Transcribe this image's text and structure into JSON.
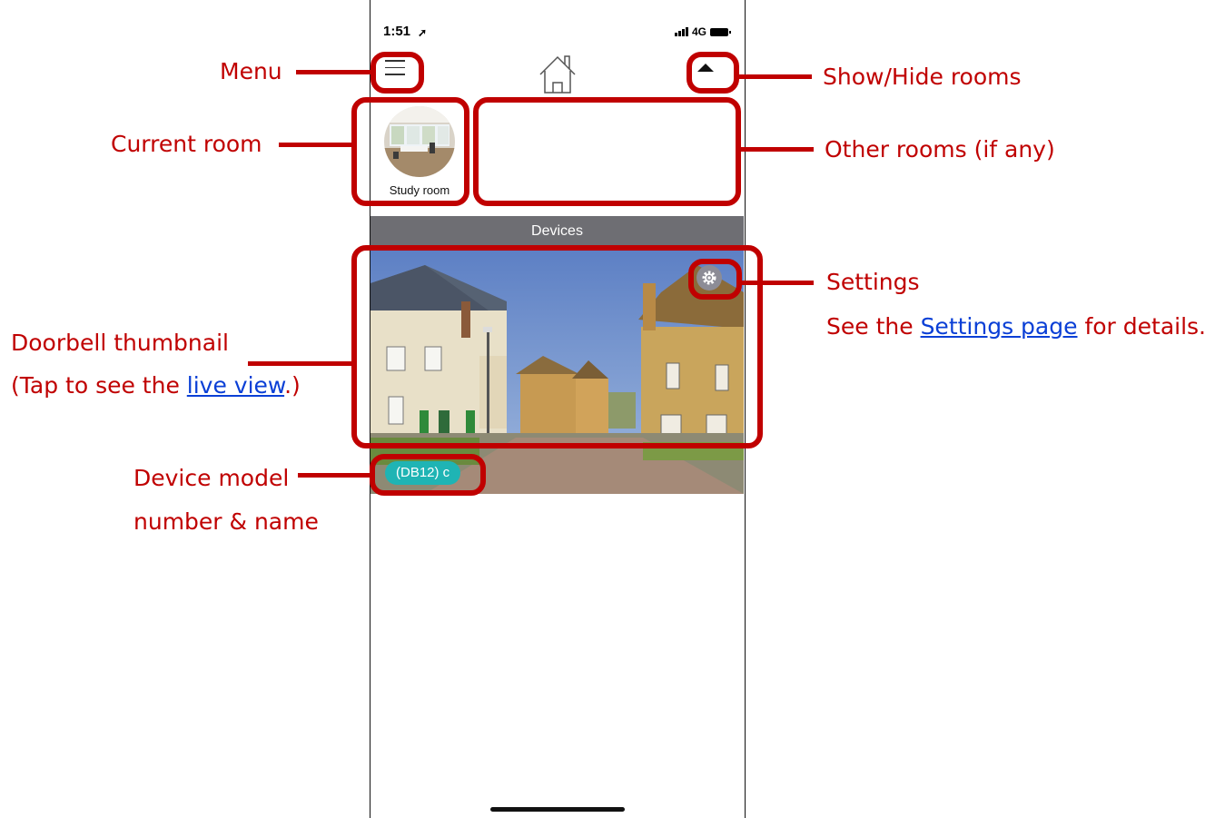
{
  "phone": {
    "status": {
      "time": "1:51",
      "network": "4G"
    },
    "current_room": {
      "label": "Study room"
    },
    "devices_header": "Devices",
    "device": {
      "tag": "(DB12) c"
    }
  },
  "annotations": {
    "menu": "Menu",
    "show_hide_rooms": "Show/Hide rooms",
    "current_room": "Current room",
    "other_rooms": "Other rooms (if any)",
    "settings": "Settings",
    "settings_detail_before": "See the ",
    "settings_detail_link": "Settings page",
    "settings_detail_after": " for details.",
    "doorbell_thumbnail": "Doorbell thumbnail",
    "doorbell_detail_before": "(Tap to see the ",
    "doorbell_detail_link": "live view",
    "doorbell_detail_after": ".)",
    "device_model_line1": "Device model",
    "device_model_line2": "number & name"
  },
  "colors": {
    "annotation": "#c00000",
    "link": "#0a3fd6",
    "tag": "#1fb4b4",
    "devices_bar": "#6e6e73"
  }
}
